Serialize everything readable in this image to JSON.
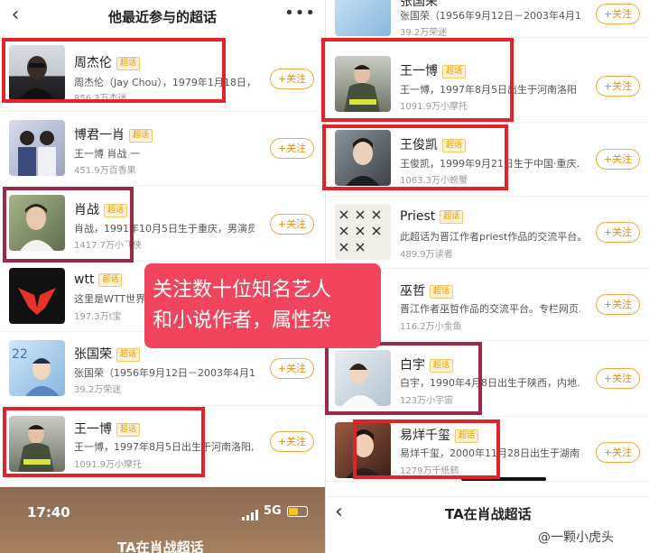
{
  "left": {
    "title": "他最近参与的超话",
    "follow_label": "+关注",
    "badge_label": "超话",
    "rows": [
      {
        "name": "周杰伦",
        "desc": "周杰伦（Jay Chou），1979年1月18日，",
        "fans": "856.3万杰迷"
      },
      {
        "name": "博君一肖",
        "desc": "王一博 肖战 一",
        "fans": "451.9万百香果"
      },
      {
        "name": "肖战",
        "desc": "肖战，1991年10月5日生于重庆，男演员…",
        "fans": "1417.7万小飞侠"
      },
      {
        "name": "wtt",
        "desc": "这里是WTT世界",
        "fans": "197.3万t宝"
      },
      {
        "name": "张国荣",
        "desc": "张国荣（1956年9月12日－2003年4月1…",
        "fans": "39.2万荣迷"
      },
      {
        "name": "王一博",
        "desc": "王一博，1997年8月5日出生于河南洛阳,",
        "fans": "1091.9万小摩托"
      }
    ],
    "status": {
      "time": "17:40",
      "network": "5G"
    },
    "next_title": "TA在肖战超话"
  },
  "right": {
    "follow_label": "+关注",
    "badge_label": "超话",
    "top_partial": {
      "name": "张国荣",
      "desc": "张国荣（1956年9月12日－2003年4月1",
      "fans": "39.2万荣迷"
    },
    "rows": [
      {
        "name": "王一博",
        "desc": "王一博，1997年8月5日出生于河南洛阳,",
        "fans": "1091.9万小摩托"
      },
      {
        "name": "王俊凯",
        "desc": "王俊凯，1999年9月21日生于中国·重庆…",
        "fans": "1063.3万小螃蟹"
      },
      {
        "name": "Priest",
        "desc": "此超话为晋江作者priest作品的交流平台。",
        "fans": "489.9万读者"
      },
      {
        "name": "巫哲",
        "desc": "晋江作者巫哲作品的交流平台。专栏网页…",
        "fans": "116.2万小金鱼"
      },
      {
        "name": "白宇",
        "desc": "白宇，1990年4月8日出生于陕西，内地…",
        "fans": "123万小宇宙"
      },
      {
        "name": "易烊千玺",
        "desc": "易烊千玺，2000年11月28日出生于湖南…",
        "fans": "1279万千纸鹤"
      }
    ],
    "next_title": "TA在肖战超话"
  },
  "overlay": {
    "line1": "关注数十位知名艺人",
    "line2": "和小说作者，属性杂"
  },
  "watermark": "@一颗小虎头",
  "colors": {
    "highlight_red": "#e0242b",
    "highlight_maroon": "#9a2846",
    "overlay_bg": "#f0455c",
    "follow_orange": "#f08a00"
  }
}
